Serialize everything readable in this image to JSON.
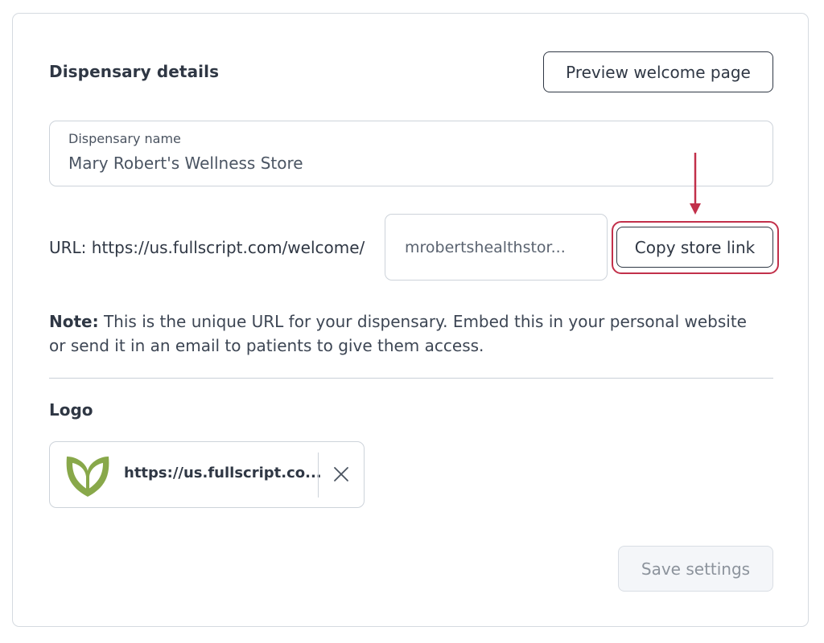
{
  "section": {
    "title": "Dispensary details",
    "preview_button": "Preview welcome page"
  },
  "dispensary_name": {
    "label": "Dispensary name",
    "value": "Mary Robert's Wellness Store"
  },
  "url": {
    "prefix": "URL: https://us.fullscript.com/welcome/",
    "slug": "mrobertshealthstor...",
    "copy_button": "Copy store link"
  },
  "note": {
    "bold": "Note:",
    "text": " This is the unique URL for your dispensary. Embed this in your personal website or send it in an email to patients to give them access."
  },
  "logo": {
    "title": "Logo",
    "url": "https://us.fullscript.co...",
    "icon": "leaf-heart-logo",
    "remove_icon": "close-icon"
  },
  "actions": {
    "save_button": "Save settings"
  },
  "colors": {
    "highlight": "#c2304a",
    "logo_green": "#88a84a",
    "text_dark": "#2f3744",
    "disabled_bg": "#f4f6f9"
  }
}
